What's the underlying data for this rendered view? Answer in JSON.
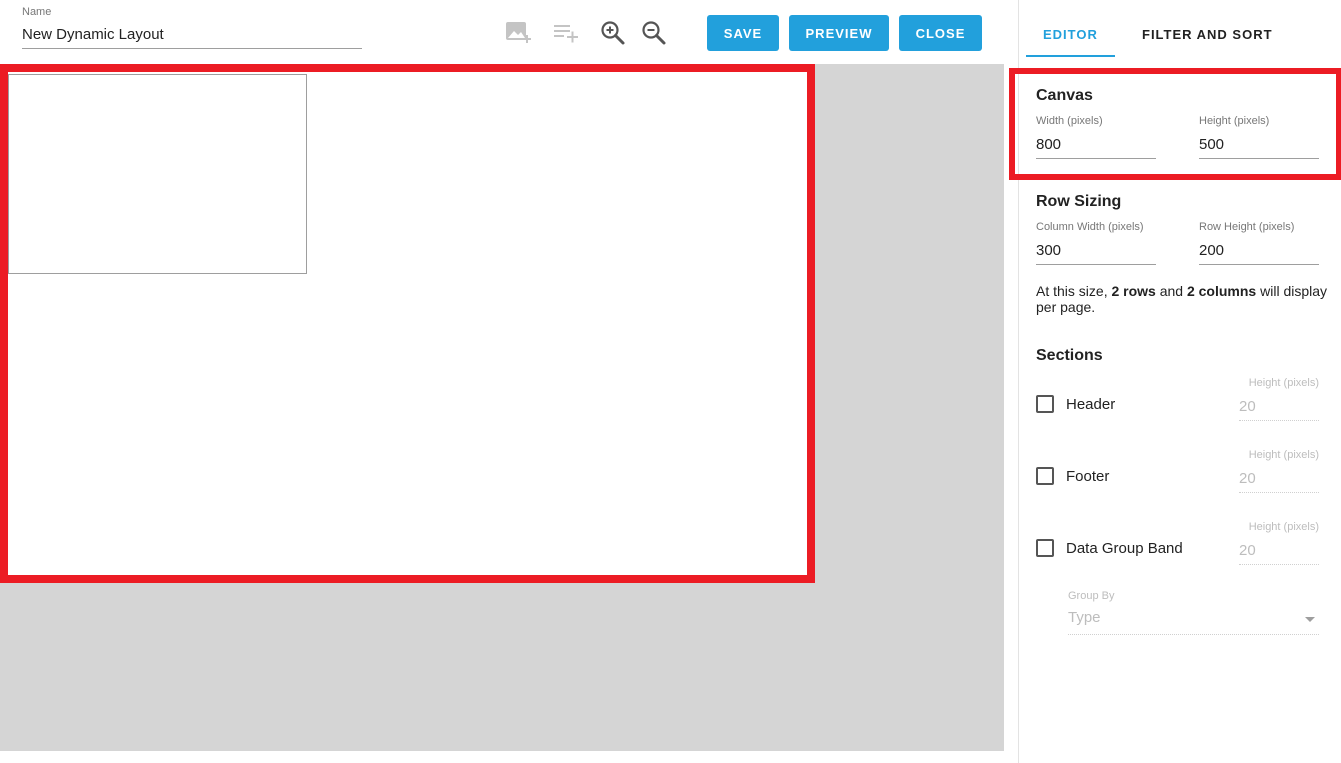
{
  "header": {
    "name_label": "Name",
    "name_value": "New Dynamic Layout",
    "tools": [
      "add-image-icon",
      "add-row-icon",
      "zoom-in-icon",
      "zoom-out-icon"
    ],
    "save_label": "SAVE",
    "preview_label": "PREVIEW",
    "close_label": "CLOSE"
  },
  "tabs": {
    "editor": "EDITOR",
    "filter_sort": "FILTER AND SORT",
    "active": "EDITOR"
  },
  "canvas": {
    "title": "Canvas",
    "width_label": "Width (pixels)",
    "width_value": "800",
    "height_label": "Height (pixels)",
    "height_value": "500"
  },
  "row_sizing": {
    "title": "Row Sizing",
    "column_width_label": "Column Width (pixels)",
    "column_width_value": "300",
    "row_height_label": "Row Height (pixels)",
    "row_height_value": "200",
    "note_prefix": "At this size, ",
    "rows_text": "2 rows",
    "note_middle": " and ",
    "columns_text": "2 columns",
    "note_suffix": " will display per page."
  },
  "sections": {
    "title": "Sections",
    "items": [
      {
        "label": "Header",
        "checked": false,
        "height_label": "Height (pixels)",
        "height_value": "20"
      },
      {
        "label": "Footer",
        "checked": false,
        "height_label": "Height (pixels)",
        "height_value": "20"
      },
      {
        "label": "Data Group Band",
        "checked": false,
        "height_label": "Height (pixels)",
        "height_value": "20"
      }
    ],
    "group_by_label": "Group By",
    "group_by_value": "Type"
  },
  "colors": {
    "accent": "#22a0dc",
    "highlight": "#ec1c24",
    "workspace": "#d5d5d5"
  }
}
